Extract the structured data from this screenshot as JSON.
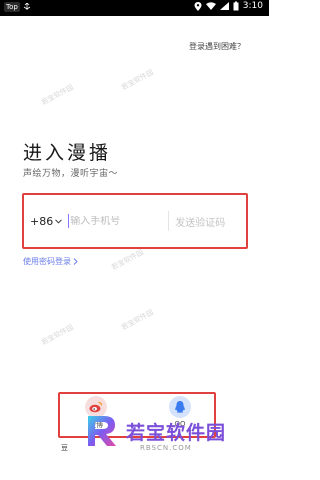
{
  "status_bar": {
    "app_badge": "Top",
    "time": "3:10"
  },
  "help_link": "登录遇到困难？",
  "title": "进入漫播",
  "subtitle": "声绘万物，漫听宇宙～",
  "phone": {
    "country_code": "+86",
    "placeholder": "输入手机号",
    "code_button": "发送验证码"
  },
  "password_login": "使用密码登录",
  "social": [
    {
      "label": "微博",
      "icon": "weibo-icon",
      "color": "#e0413f"
    },
    {
      "label": "QQ",
      "icon": "qq-icon",
      "color": "#3b7bf0"
    }
  ],
  "agreement_prefix": "豆",
  "watermark": "若宝软件园",
  "brand": {
    "name": "若宝软件园",
    "url": "RBSCN.COM"
  },
  "colors": {
    "highlight_border": "#e0413f",
    "link": "#6b7de8",
    "brand": "#7b4fd9"
  }
}
